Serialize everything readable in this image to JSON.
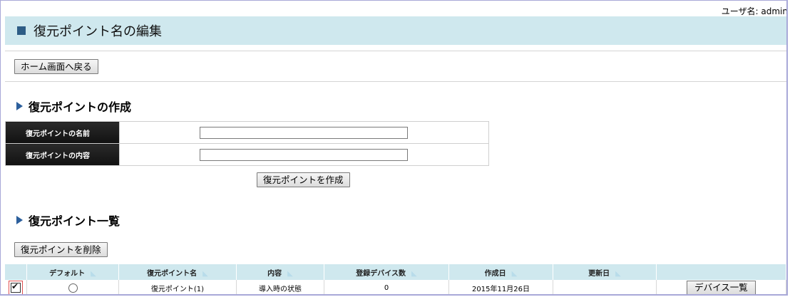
{
  "user": {
    "label": "ユーザ名: admin"
  },
  "header": {
    "title": "復元ポイント名の編集"
  },
  "buttons": {
    "home": "ホーム画面へ戻る",
    "create": "復元ポイントを作成",
    "delete": "復元ポイントを削除"
  },
  "create_section": {
    "title": "復元ポイントの作成",
    "name_label": "復元ポイントの名前",
    "name_value": "",
    "content_label": "復元ポイントの内容",
    "content_value": ""
  },
  "list_section": {
    "title": "復元ポイント一覧",
    "columns": [
      "デフォルト",
      "復元ポイント名",
      "内容",
      "登録デバイス数",
      "作成日",
      "更新日"
    ],
    "rows": [
      {
        "checked": true,
        "default": false,
        "name": "復元ポイント(1)",
        "content": "導入時の状態",
        "device_count": "0",
        "created": "2015年11月26日",
        "updated": "",
        "action": "デバイス一覧"
      }
    ]
  },
  "colors": {
    "header_bg": "#cfe8ee",
    "accent": "#2e5d86",
    "label_bg": "#1a1a1a"
  }
}
